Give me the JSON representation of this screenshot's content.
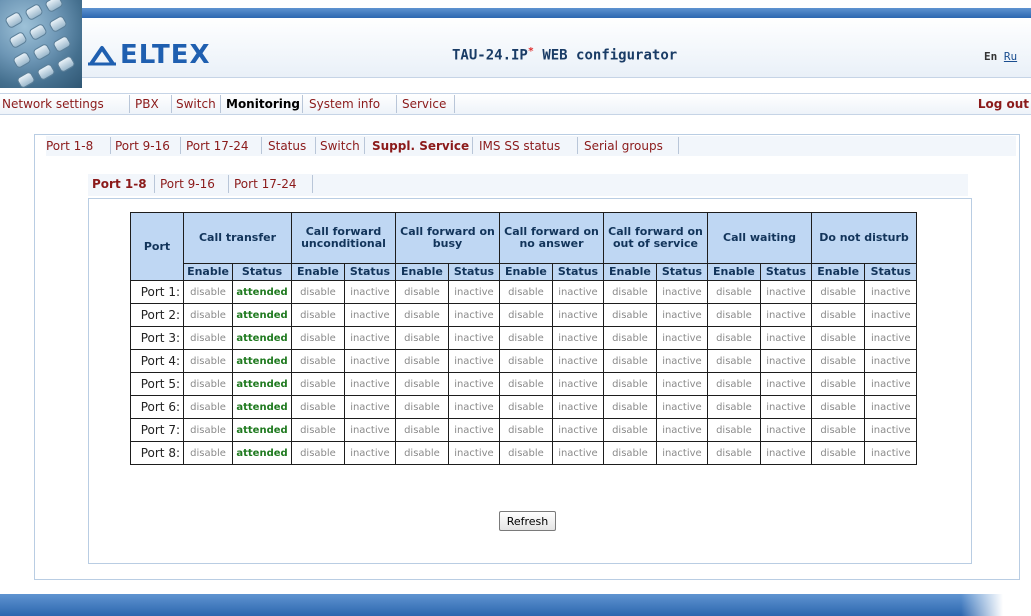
{
  "header": {
    "logo_text": "ELTEX",
    "title": "TAU-24.IP",
    "title_mark": "*",
    "title_suffix": " WEB configurator",
    "lang_en": "En",
    "lang_ru": "Ru"
  },
  "main_menu": {
    "items": [
      "Network settings",
      "PBX",
      "Switch",
      "Monitoring",
      "System info",
      "Service"
    ],
    "active": "Monitoring",
    "logout": "Log out"
  },
  "sub_menu": {
    "items": [
      "Port 1-8",
      "Port 9-16",
      "Port 17-24",
      "Status",
      "Switch",
      "Suppl. Service",
      "IMS SS status",
      "Serial groups"
    ],
    "active": "Suppl. Service"
  },
  "port_tabs": {
    "items": [
      "Port 1-8",
      "Port 9-16",
      "Port 17-24"
    ],
    "active": "Port 1-8"
  },
  "table": {
    "port_header": "Port",
    "group_headers": [
      "Call transfer",
      "Call forward unconditional",
      "Call forward on busy",
      "Call forward on no answer",
      "Call forward on out of service",
      "Call waiting",
      "Do not disturb"
    ],
    "sub_headers": [
      "Enable",
      "Status"
    ],
    "rows": [
      {
        "port": "Port 1:",
        "values": [
          "disable",
          "attended",
          "disable",
          "inactive",
          "disable",
          "inactive",
          "disable",
          "inactive",
          "disable",
          "inactive",
          "disable",
          "inactive",
          "disable",
          "inactive"
        ]
      },
      {
        "port": "Port 2:",
        "values": [
          "disable",
          "attended",
          "disable",
          "inactive",
          "disable",
          "inactive",
          "disable",
          "inactive",
          "disable",
          "inactive",
          "disable",
          "inactive",
          "disable",
          "inactive"
        ]
      },
      {
        "port": "Port 3:",
        "values": [
          "disable",
          "attended",
          "disable",
          "inactive",
          "disable",
          "inactive",
          "disable",
          "inactive",
          "disable",
          "inactive",
          "disable",
          "inactive",
          "disable",
          "inactive"
        ]
      },
      {
        "port": "Port 4:",
        "values": [
          "disable",
          "attended",
          "disable",
          "inactive",
          "disable",
          "inactive",
          "disable",
          "inactive",
          "disable",
          "inactive",
          "disable",
          "inactive",
          "disable",
          "inactive"
        ]
      },
      {
        "port": "Port 5:",
        "values": [
          "disable",
          "attended",
          "disable",
          "inactive",
          "disable",
          "inactive",
          "disable",
          "inactive",
          "disable",
          "inactive",
          "disable",
          "inactive",
          "disable",
          "inactive"
        ]
      },
      {
        "port": "Port 6:",
        "values": [
          "disable",
          "attended",
          "disable",
          "inactive",
          "disable",
          "inactive",
          "disable",
          "inactive",
          "disable",
          "inactive",
          "disable",
          "inactive",
          "disable",
          "inactive"
        ]
      },
      {
        "port": "Port 7:",
        "values": [
          "disable",
          "attended",
          "disable",
          "inactive",
          "disable",
          "inactive",
          "disable",
          "inactive",
          "disable",
          "inactive",
          "disable",
          "inactive",
          "disable",
          "inactive"
        ]
      },
      {
        "port": "Port 8:",
        "values": [
          "disable",
          "attended",
          "disable",
          "inactive",
          "disable",
          "inactive",
          "disable",
          "inactive",
          "disable",
          "inactive",
          "disable",
          "inactive",
          "disable",
          "inactive"
        ]
      }
    ]
  },
  "refresh_label": "Refresh",
  "colors": {
    "brand_blue": "#1f5fb0",
    "header_bar": "#2d67b0",
    "table_header_bg": "#bfd7f3",
    "menu_link": "#8b1a1a",
    "attended_green": "#1f7a1f",
    "muted_gray": "#8a8a8a"
  },
  "icons": {
    "logo": "eltex-logo-icon",
    "header_photo": "phone-keypad-photo-icon"
  }
}
